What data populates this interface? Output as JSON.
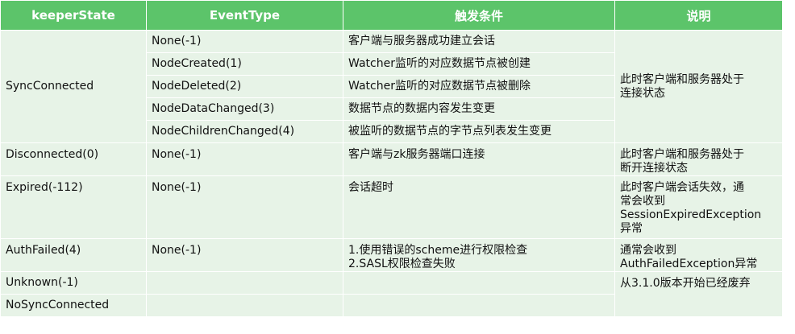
{
  "table": {
    "headers": [
      "keeperState",
      "EventType",
      "触发条件",
      "说明"
    ],
    "rows": [
      {
        "keeperState": "SyncConnected",
        "eventType": "None(-1)",
        "condition": "客户端与服务器成功建立会话",
        "description": "此时客户端和服务器处于\n连接状态"
      },
      {
        "eventType": "NodeCreated(1)",
        "condition": "Watcher监听的对应数据节点被创建"
      },
      {
        "eventType": "NodeDeleted(2)",
        "condition": "Watcher监听的对应数据节点被删除"
      },
      {
        "eventType": "NodeDataChanged(3)",
        "condition": "数据节点的数据内容发生变更"
      },
      {
        "eventType": "NodeChildrenChanged(4)",
        "condition": "被监听的数据节点的字节点列表发生变更"
      },
      {
        "keeperState": "Disconnected(0)",
        "eventType": "None(-1)",
        "condition": "客户端与zk服务器端口连接",
        "description": "此时客户端和服务器处于\n断开连接状态"
      },
      {
        "keeperState": "Expired(-112)",
        "eventType": "None(-1)",
        "condition": "会话超时",
        "description": "此时客户端会话失效，通\n常会收到\nSessionExpiredException\n异常"
      },
      {
        "keeperState": "AuthFailed(4)",
        "eventType": "None(-1)",
        "condition": "1.使用错误的scheme进行权限检查\n2.SASL权限检查失败",
        "description": "通常会收到\nAuthFailedException异常"
      },
      {
        "keeperState": "Unknown(-1)",
        "eventType": "",
        "condition": "",
        "description": "从3.1.0版本开始已经废弃"
      },
      {
        "keeperState": "NoSyncConnected",
        "eventType": "",
        "condition": ""
      }
    ]
  }
}
